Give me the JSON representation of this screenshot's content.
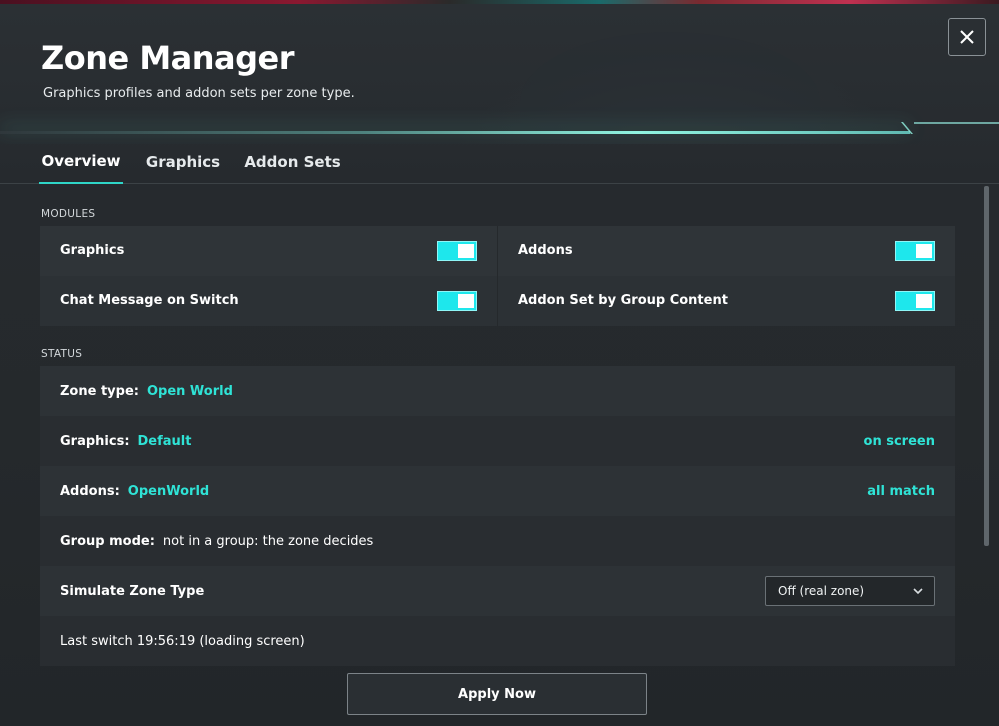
{
  "window": {
    "title": "Zone Manager",
    "subtitle": "Graphics profiles and addon sets per zone type."
  },
  "icons": {
    "close": "close-icon",
    "dropdown_chevron": "chevron-down-icon"
  },
  "colors": {
    "accent": "#2fe3d6",
    "toggle_on": "#1ee7ec",
    "panel_bg": "#262a2e"
  },
  "tabs": [
    {
      "label": "Overview",
      "active": true
    },
    {
      "label": "Graphics",
      "active": false
    },
    {
      "label": "Addon Sets",
      "active": false
    }
  ],
  "modules": {
    "section_label": "MODULES",
    "items": [
      {
        "label": "Graphics",
        "enabled": true
      },
      {
        "label": "Addons",
        "enabled": true
      },
      {
        "label": "Chat Message on Switch",
        "enabled": true
      },
      {
        "label": "Addon Set by Group Content",
        "enabled": true
      }
    ]
  },
  "status": {
    "section_label": "STATUS",
    "zone_type": {
      "key": "Zone type:",
      "value": "Open World"
    },
    "graphics": {
      "key": "Graphics:",
      "value": "Default",
      "right": "on screen"
    },
    "addons": {
      "key": "Addons:",
      "value": "OpenWorld",
      "right": "all match"
    },
    "group_mode": {
      "key": "Group mode:",
      "value": "not in a group: the zone decides"
    },
    "simulate": {
      "key": "Simulate Zone Type",
      "selected": "Off (real zone)"
    },
    "last_switch": "Last switch 19:56:19 (loading screen)"
  },
  "actions": {
    "apply_label": "Apply Now"
  }
}
